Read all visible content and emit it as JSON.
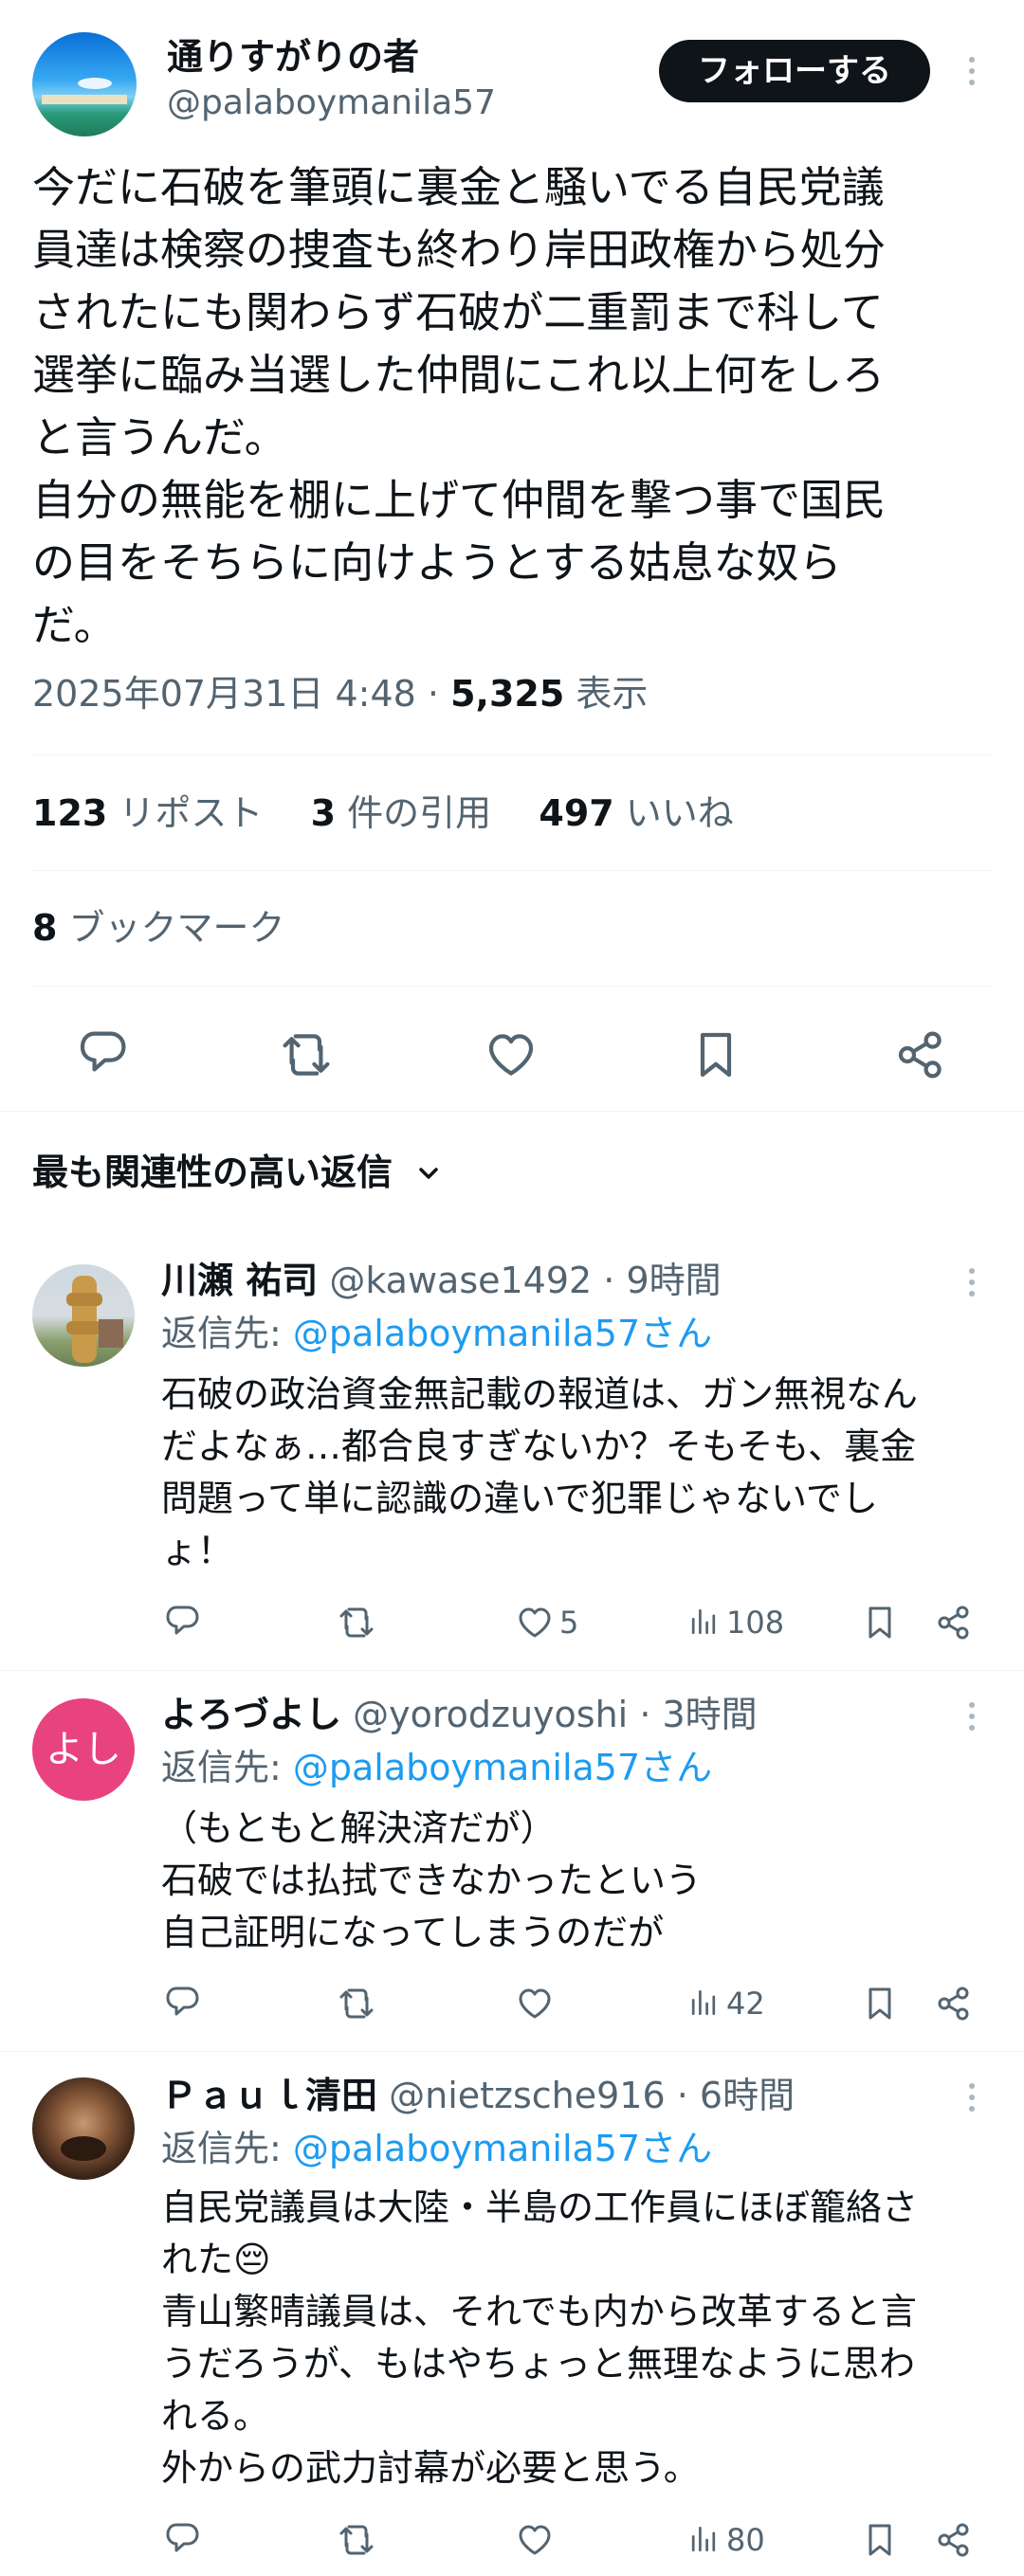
{
  "post": {
    "display_name": "通りすがりの者",
    "handle": "@palaboymanila57",
    "follow_label": "フォローする",
    "lines": [
      "今だに石破を筆頭に裏金と騒いでる自民党議",
      "員達は検察の捜査も終わり岸田政権から処分",
      "されたにも関わらず石破が二重罰まで科して",
      "選挙に臨み当選した仲間にこれ以上何をしろ",
      "と言うんだ。",
      "自分の無能を棚に上げて仲間を撃つ事で国民",
      "の目をそちらに向けようとする姑息な奴ら",
      "だ。"
    ],
    "timestamp": "2025年07月31日 4:48",
    "dot": "·",
    "views_count": "5,325",
    "views_label": "表示",
    "reposts_count": "123",
    "reposts_label": "リポスト",
    "quotes_count": "3",
    "quotes_label": "件の引用",
    "likes_count": "497",
    "likes_label": "いいね",
    "bookmarks_count": "8",
    "bookmarks_label": "ブックマーク"
  },
  "replies_filter": {
    "label": "最も関連性の高い返信"
  },
  "replies": [
    {
      "name": "川瀬 祐司",
      "handle": "@kawase1492",
      "time": "· 9時間",
      "reply_to_prefix": "返信先: ",
      "reply_to": "@palaboymanila57さん",
      "lines": [
        "石破の政治資金無記載の報道は、ガン無視なん",
        "だよなぁ…都合良すぎないか？そもそも、裏金",
        "問題って単に認識の違いで犯罪じゃないでし",
        "ょ！"
      ],
      "likes": "5",
      "views": "108"
    },
    {
      "name": "よろづよし",
      "handle": "@yorodzuyoshi",
      "time": "· 3時間",
      "avatar_text": "よし",
      "reply_to_prefix": "返信先: ",
      "reply_to": "@palaboymanila57さん",
      "lines": [
        "（もともと解決済だが）",
        "石破では払拭できなかったという",
        "自己証明になってしまうのだが"
      ],
      "likes": "",
      "views": "42"
    },
    {
      "name": "Ｐａｕｌ清田",
      "handle": "@nietzsche916",
      "time": "· 6時間",
      "reply_to_prefix": "返信先: ",
      "reply_to": "@palaboymanila57さん",
      "lines": [
        "自民党議員は大陸・半島の工作員にほぼ籠絡さ",
        "れた😔",
        "青山繁晴議員は、それでも内から改革すると言",
        "うだろうが、もはやちょっと無理なように思わ",
        "れる。",
        "外からの武力討幕が必要と思う。"
      ],
      "likes": "",
      "views": "80"
    }
  ],
  "icons": {
    "reply": "reply-icon",
    "repost": "repost-icon",
    "like": "heart-icon",
    "bookmark": "bookmark-icon",
    "share": "share-icon",
    "views": "views-icon",
    "more": "more-icon"
  },
  "colors": {
    "accent": "#1d9bf0",
    "muted": "#536471",
    "follow_bg": "#0f1419",
    "avatar_yoshi": "#e8437e"
  }
}
